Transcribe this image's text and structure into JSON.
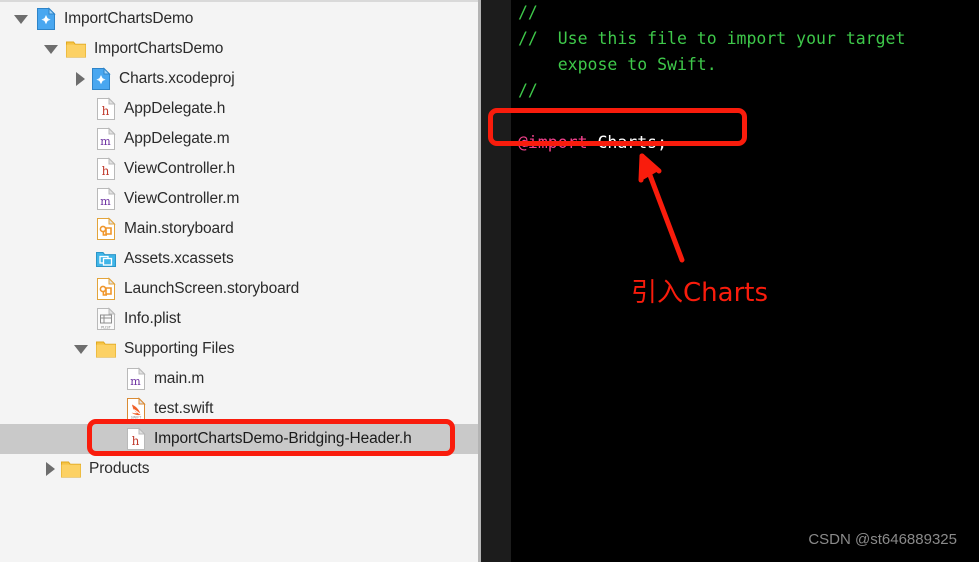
{
  "navigator": {
    "name": "project-navigator",
    "rows": [
      {
        "label": "ImportChartsDemo",
        "icon": "xcodeproj-icon",
        "depth": 0,
        "disclosure": "open",
        "selected": false
      },
      {
        "label": "ImportChartsDemo",
        "icon": "folder-icon",
        "depth": 1,
        "disclosure": "open",
        "selected": false
      },
      {
        "label": "Charts.xcodeproj",
        "icon": "xcodeproj-icon",
        "depth": 2,
        "disclosure": "closed",
        "selected": false
      },
      {
        "label": "AppDelegate.h",
        "icon": "header-file-icon",
        "depth": 2,
        "disclosure": "none",
        "selected": false
      },
      {
        "label": "AppDelegate.m",
        "icon": "objc-file-icon",
        "depth": 2,
        "disclosure": "none",
        "selected": false
      },
      {
        "label": "ViewController.h",
        "icon": "header-file-icon",
        "depth": 2,
        "disclosure": "none",
        "selected": false
      },
      {
        "label": "ViewController.m",
        "icon": "objc-file-icon",
        "depth": 2,
        "disclosure": "none",
        "selected": false
      },
      {
        "label": "Main.storyboard",
        "icon": "storyboard-icon",
        "depth": 2,
        "disclosure": "none",
        "selected": false
      },
      {
        "label": "Assets.xcassets",
        "icon": "xcassets-icon",
        "depth": 2,
        "disclosure": "none",
        "selected": false
      },
      {
        "label": "LaunchScreen.storyboard",
        "icon": "storyboard-icon",
        "depth": 2,
        "disclosure": "none",
        "selected": false
      },
      {
        "label": "Info.plist",
        "icon": "plist-icon",
        "depth": 2,
        "disclosure": "none",
        "selected": false
      },
      {
        "label": "Supporting Files",
        "icon": "folder-icon",
        "depth": 2,
        "disclosure": "open",
        "selected": false
      },
      {
        "label": "main.m",
        "icon": "objc-file-icon",
        "depth": 3,
        "disclosure": "none",
        "selected": false
      },
      {
        "label": "test.swift",
        "icon": "swift-file-icon",
        "depth": 3,
        "disclosure": "none",
        "selected": false
      },
      {
        "label": "ImportChartsDemo-Bridging-Header.h",
        "icon": "header-file-icon",
        "depth": 3,
        "disclosure": "none",
        "selected": true
      },
      {
        "label": "Products",
        "icon": "folder-icon",
        "depth": 1,
        "disclosure": "closed",
        "selected": false
      }
    ]
  },
  "editor": {
    "name": "source-editor",
    "lines": [
      {
        "tokens": [
          {
            "text": "//",
            "type": "comment"
          }
        ]
      },
      {
        "tokens": [
          {
            "text": "//  Use this file to import your target",
            "type": "comment"
          }
        ]
      },
      {
        "tokens": [
          {
            "text": "    expose to Swift.",
            "type": "comment"
          }
        ]
      },
      {
        "tokens": [
          {
            "text": "//",
            "type": "comment"
          }
        ]
      },
      {
        "tokens": []
      },
      {
        "tokens": [
          {
            "text": "@import",
            "type": "keyword"
          },
          {
            "text": " Charts;",
            "type": "plain"
          }
        ]
      }
    ]
  },
  "annotations": {
    "callout_text": "引入Charts",
    "color": "#f91c0c",
    "code_highlight_label": "@import Charts;",
    "file_highlight_label": "ImportChartsDemo-Bridging-Header.h"
  },
  "watermark": {
    "text": "CSDN @st646889325"
  },
  "colors": {
    "accent_red": "#f91c0c",
    "comment_green": "#3ec84a",
    "keyword_pink": "#f2408c",
    "editor_background": "#000000",
    "sidebar_background": "#f4f4f4",
    "selection_gray": "#c9c9c9"
  }
}
